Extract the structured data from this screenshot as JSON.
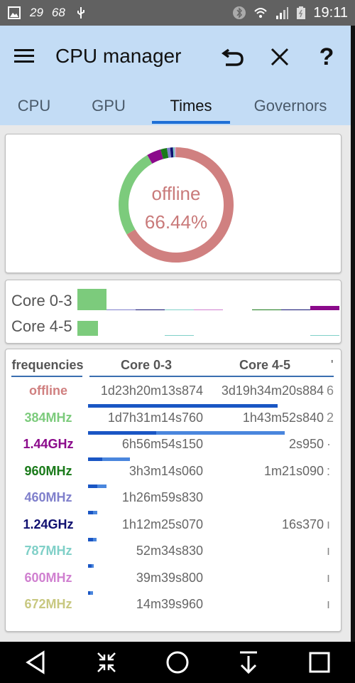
{
  "statusbar": {
    "time": "19:11",
    "left_icons": [
      "image-icon",
      "temp-29-icon",
      "temp-68-icon",
      "usb-icon"
    ],
    "right_icons": [
      "bluetooth-icon",
      "wifi-icon",
      "signal-icon",
      "battery-charging-icon"
    ],
    "temp1": "29",
    "temp2": "68"
  },
  "app": {
    "title": "CPU manager",
    "menu_icon": "hamburger-menu-icon",
    "actions": [
      {
        "name": "undo",
        "icon": "undo-icon"
      },
      {
        "name": "close",
        "icon": "close-icon",
        "glyph": "✕"
      },
      {
        "name": "help",
        "icon": "help-icon",
        "glyph": "?"
      }
    ]
  },
  "tabs": [
    {
      "label": "CPU",
      "active": false
    },
    {
      "label": "GPU",
      "active": false
    },
    {
      "label": "Times",
      "active": true
    },
    {
      "label": "Governors",
      "active": false
    }
  ],
  "colors": {
    "accent": "#1f6fd6",
    "appbar": "#c3dcf5",
    "offline": "#d08080",
    "384MHz": "#7ccb7c",
    "1.44GHz": "#8b0a8b",
    "960MHz": "#1a7a1a",
    "460MHz": "#8080cc",
    "1.24GHz": "#101070",
    "787MHz": "#80d0c8",
    "600MHz": "#d080d0",
    "672MHz": "#c8c880"
  },
  "donut": {
    "label": "offline",
    "percent_text": "66.44%",
    "segments": [
      {
        "name": "offline",
        "percent": 66.44
      },
      {
        "name": "384MHz",
        "percent": 25.2
      },
      {
        "name": "1.44GHz",
        "percent": 4.0
      },
      {
        "name": "960MHz",
        "percent": 1.8
      },
      {
        "name": "460MHz",
        "percent": 0.9
      },
      {
        "name": "1.24GHz",
        "percent": 0.8
      },
      {
        "name": "787MHz",
        "percent": 0.5
      },
      {
        "name": "600MHz",
        "percent": 0.3
      },
      {
        "name": "672MHz",
        "percent": 0.06
      }
    ]
  },
  "core_bars": {
    "rows": [
      {
        "label": "Core 0-3",
        "segments": [
          {
            "name": "384MHz",
            "value": 1.0
          },
          {
            "name": "460MHz",
            "value": 0.02
          },
          {
            "name": "1.24GHz",
            "value": 0.015
          },
          {
            "name": "787MHz",
            "value": 0.01
          },
          {
            "name": "600MHz",
            "value": 0.01
          },
          {
            "name": "672MHz",
            "value": 0.0
          },
          {
            "name": "960MHz",
            "value": 0.04
          },
          {
            "name": "1.24GHz",
            "value": 0.02
          },
          {
            "name": "1.44GHz",
            "value": 0.2
          }
        ]
      },
      {
        "label": "Core 4-5",
        "segments": [
          {
            "name": "384MHz",
            "value": 0.7
          },
          {
            "name": "460MHz",
            "value": 0.0
          },
          {
            "name": "1.24GHz",
            "value": 0.0
          },
          {
            "name": "787MHz",
            "value": 0.01
          },
          {
            "name": "600MHz",
            "value": 0.0
          },
          {
            "name": "672MHz",
            "value": 0.0
          },
          {
            "name": "960MHz",
            "value": 0.0
          },
          {
            "name": "1.24GHz",
            "value": 0.0
          },
          {
            "name": "787MHz",
            "value": 0.02
          }
        ]
      }
    ]
  },
  "table": {
    "headers": [
      "frequencies",
      "Core 0-3",
      "Core 4-5",
      "'"
    ],
    "rows": [
      {
        "freq": "offline",
        "core03": "1d23h20m13s874",
        "core45": "3d19h34m20s884",
        "extra": "6",
        "bar_total": 0.81,
        "bar_current": 0.81
      },
      {
        "freq": "384MHz",
        "core03": "1d7h31m14s760",
        "core45": "1h43m52s840",
        "extra": "2",
        "bar_total": 0.84,
        "bar_current": 0.29
      },
      {
        "freq": "1.44GHz",
        "core03": "6h56m54s150",
        "core45": "2s950",
        "extra": "·",
        "bar_total": 0.18,
        "bar_current": 0.06
      },
      {
        "freq": "960MHz",
        "core03": "3h3m14s060",
        "core45": "1m21s090",
        "extra": ":",
        "bar_total": 0.08,
        "bar_current": 0.04
      },
      {
        "freq": "460MHz",
        "core03": "1h26m59s830",
        "core45": "",
        "extra": "",
        "bar_total": 0.04,
        "bar_current": 0.02
      },
      {
        "freq": "1.24GHz",
        "core03": "1h12m25s070",
        "core45": "16s370",
        "extra": "ı",
        "bar_total": 0.035,
        "bar_current": 0.02
      },
      {
        "freq": "787MHz",
        "core03": "52m34s830",
        "core45": "",
        "extra": "ı",
        "bar_total": 0.025,
        "bar_current": 0.015
      },
      {
        "freq": "600MHz",
        "core03": "39m39s800",
        "core45": "",
        "extra": "ı",
        "bar_total": 0.02,
        "bar_current": 0.01
      },
      {
        "freq": "672MHz",
        "core03": "14m39s960",
        "core45": "",
        "extra": "ı",
        "bar_total": 0.0,
        "bar_current": 0.0
      }
    ]
  },
  "navbar": [
    "back-icon",
    "collapse-icon",
    "home-icon",
    "download-icon",
    "recents-icon"
  ]
}
